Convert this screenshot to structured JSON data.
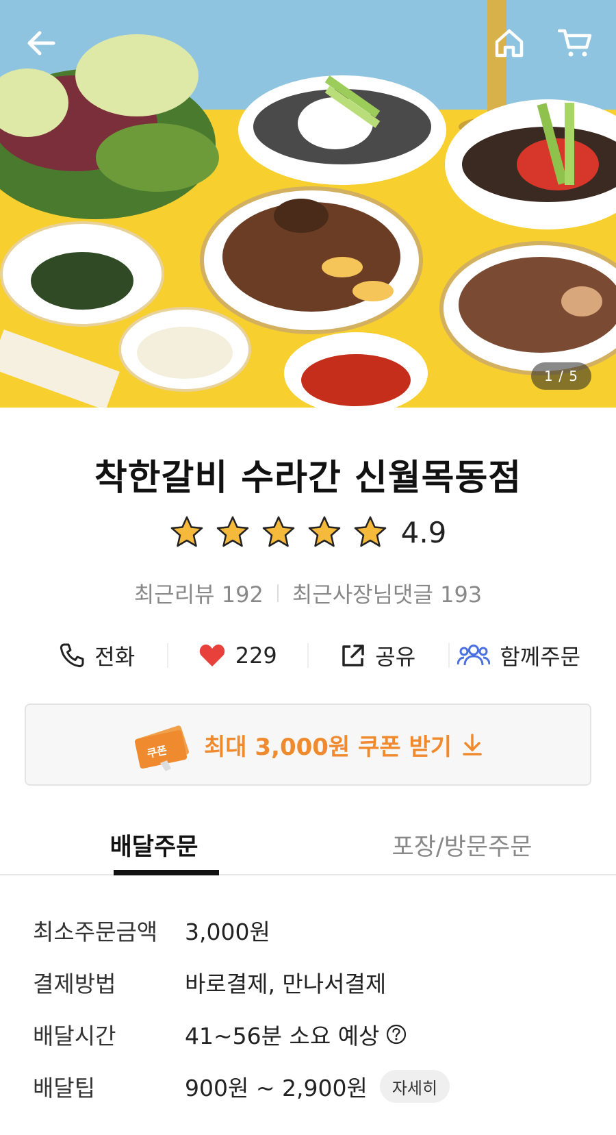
{
  "header": {
    "back_icon": "arrow-left-icon",
    "home_icon": "home-icon",
    "cart_icon": "cart-icon",
    "image_counter": "1 / 5"
  },
  "store": {
    "name": "착한갈비 수라간 신월목동점",
    "rating": "4.9",
    "rating_stars": 5,
    "recent_reviews": "최근리뷰 192",
    "recent_owner_comments": "최근사장님댓글 193"
  },
  "actions": {
    "call_label": "전화",
    "like_count": "229",
    "share_label": "공유",
    "group_order_label": "함께주문"
  },
  "coupon": {
    "badge_text": "쿠폰",
    "label": "최대 3,000원 쿠폰 받기"
  },
  "tabs": {
    "delivery": "배달주문",
    "pickup": "포장/방문주문"
  },
  "info": {
    "min_order_label": "최소주문금액",
    "min_order_value": "3,000원",
    "payment_label": "결제방법",
    "payment_value": "바로결제, 만나서결제",
    "delivery_time_label": "배달시간",
    "delivery_time_value": "41~56분 소요 예상",
    "delivery_tip_label": "배달팁",
    "delivery_tip_value": "900원 ~ 2,900원",
    "detail_button": "자세히"
  },
  "colors": {
    "accent_orange": "#ef8a2e",
    "heart_red": "#e8403b",
    "group_blue": "#4a6fe0",
    "star_gold": "#f5b93c"
  }
}
